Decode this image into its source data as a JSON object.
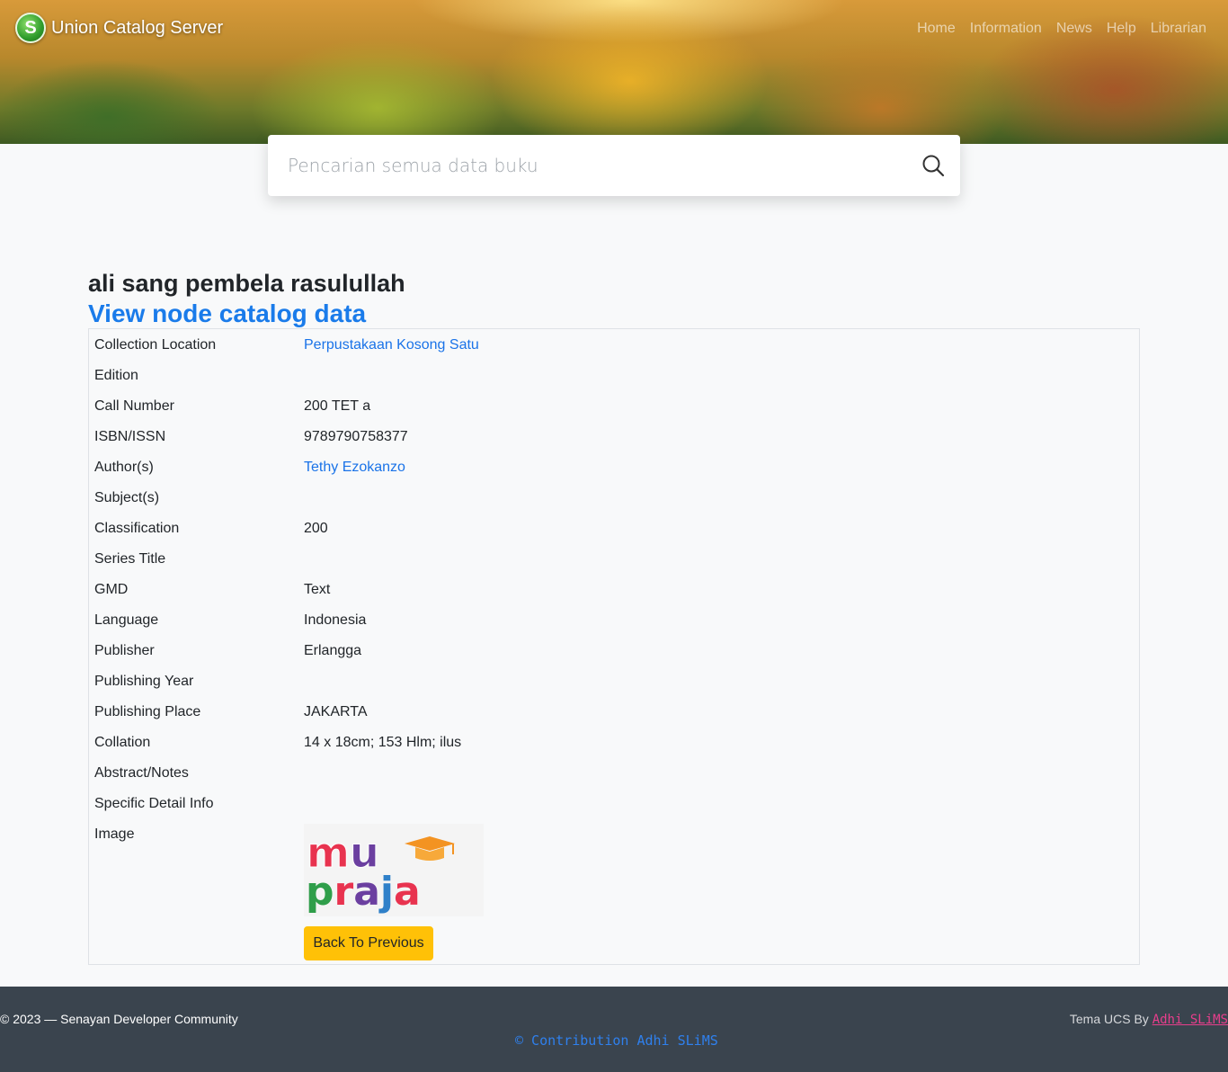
{
  "header": {
    "brand": "Union Catalog Server",
    "logo_letter": "S",
    "nav": [
      "Home",
      "Information",
      "News",
      "Help",
      "Librarian"
    ]
  },
  "search": {
    "placeholder": "Pencarian semua data buku"
  },
  "record": {
    "title": "ali sang pembela rasulullah",
    "node_link": "View node catalog data",
    "fields": [
      {
        "label": "Collection Location",
        "value": "Perpustakaan Kosong Satu",
        "link": true
      },
      {
        "label": "Edition",
        "value": ""
      },
      {
        "label": "Call Number",
        "value": "200 TET a"
      },
      {
        "label": "ISBN/ISSN",
        "value": "9789790758377"
      },
      {
        "label": "Author(s)",
        "value": "Tethy Ezokanzo",
        "link": true
      },
      {
        "label": "Subject(s)",
        "value": ""
      },
      {
        "label": "Classification",
        "value": "200"
      },
      {
        "label": "Series Title",
        "value": ""
      },
      {
        "label": "GMD",
        "value": "Text"
      },
      {
        "label": "Language",
        "value": "Indonesia"
      },
      {
        "label": "Publisher",
        "value": "Erlangga"
      },
      {
        "label": "Publishing Year",
        "value": ""
      },
      {
        "label": "Publishing Place",
        "value": "JAKARTA"
      },
      {
        "label": "Collation",
        "value": "14 x 18cm; 153 Hlm; ilus"
      },
      {
        "label": "Abstract/Notes",
        "value": ""
      },
      {
        "label": "Specific Detail Info",
        "value": ""
      },
      {
        "label": "Image",
        "value": ""
      }
    ],
    "cover_text": [
      "mu",
      "praja"
    ],
    "back_button": "Back To Previous"
  },
  "footer": {
    "copyright": "© 2023 — Senayan Developer Community",
    "credit": "© Contribution Adhi SLiMS",
    "theme_prefix": "Tema UCS By ",
    "theme_author": "Adhi SLiMS"
  },
  "colors": {
    "link": "#1a73e8",
    "button": "#ffc107",
    "footer_bg": "#3a444e",
    "accent_pink": "#e83e8c"
  }
}
